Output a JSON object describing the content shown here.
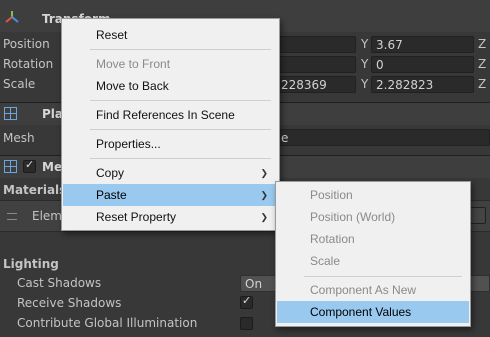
{
  "inspector": {
    "transform_header": "Transform",
    "position_label": "Position",
    "rotation_label": "Rotation",
    "scale_label": "Scale",
    "position_y_axis": "Y",
    "position_y_value": "3.67",
    "position_z_axis": "Z",
    "rotation_y_axis": "Y",
    "rotation_y_value": "0",
    "rotation_z_axis": "Z",
    "scale_x_partial": "228369",
    "scale_y_axis": "Y",
    "scale_y_value": "2.282823",
    "scale_z_axis": "Z",
    "plane_header_partial": "Pla",
    "mesh_label": "Mesh",
    "mesh_value_partial": "e",
    "mesh_renderer_header_partial": "Me",
    "materials_label": "Materials",
    "element_partial": "Eleme",
    "lighting_label": "Lighting",
    "cast_shadows_label": "Cast Shadows",
    "cast_shadows_value": "On",
    "receive_shadows_label": "Receive Shadows",
    "receive_shadows_checked": true,
    "contribute_gi_label": "Contribute Global Illumination"
  },
  "context_menu": {
    "items": [
      {
        "label": "Reset",
        "enabled": true
      },
      {
        "label": "Move to Front",
        "enabled": false
      },
      {
        "label": "Move to Back",
        "enabled": true
      },
      {
        "label": "Find References In Scene",
        "enabled": true
      },
      {
        "label": "Properties...",
        "enabled": true
      },
      {
        "label": "Copy",
        "enabled": true,
        "submenu": true
      },
      {
        "label": "Paste",
        "enabled": true,
        "submenu": true,
        "highlighted": true
      },
      {
        "label": "Reset Property",
        "enabled": true,
        "submenu": true
      }
    ]
  },
  "paste_submenu": {
    "items": [
      {
        "label": "Position",
        "enabled": false
      },
      {
        "label": "Position (World)",
        "enabled": false
      },
      {
        "label": "Rotation",
        "enabled": false
      },
      {
        "label": "Scale",
        "enabled": false
      },
      {
        "label": "Component As New",
        "enabled": false
      },
      {
        "label": "Component Values",
        "enabled": true,
        "highlighted": true
      }
    ]
  },
  "colors": {
    "inspector_bg": "#383838",
    "menu_bg": "#f0f0f0",
    "menu_highlight": "#99c9ef",
    "disabled_text": "#8a8a8a"
  }
}
